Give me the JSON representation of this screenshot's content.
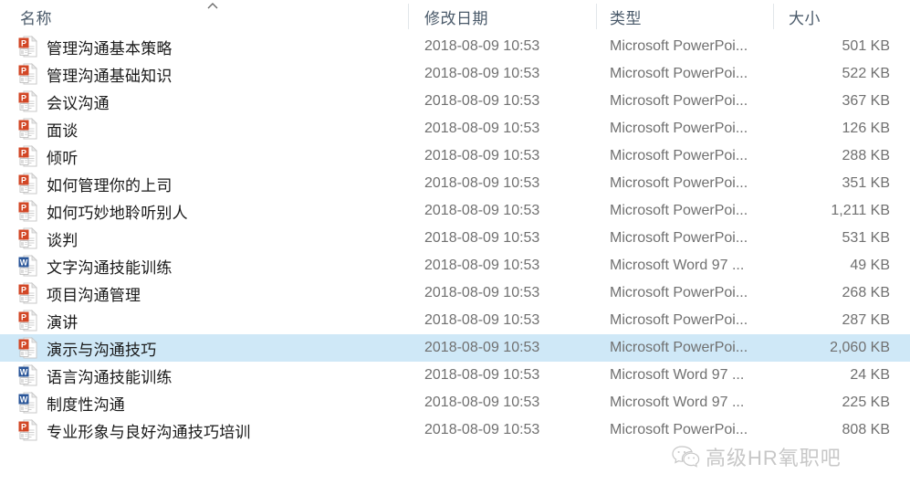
{
  "window": {
    "view": "details",
    "sort_column": "名称",
    "sort_direction": "ascending"
  },
  "columns": {
    "name": "名称",
    "date_modified": "修改日期",
    "type": "类型",
    "size": "大小"
  },
  "colors": {
    "selection": "#cfe8f7",
    "powerpoint_icon": "#d24726",
    "word_icon": "#2a5699",
    "header_text": "#4a5a6a",
    "row_text": "#1a1a1a",
    "meta_text": "#707070"
  },
  "watermark": {
    "text": "高级HR氧职吧",
    "logo": "wechat-icon"
  },
  "files": [
    {
      "name": "管理沟通基本策略",
      "date": "2018-08-09 10:53",
      "type": "Microsoft PowerPoi...",
      "size": "501 KB",
      "icon": "powerpoint-file-icon",
      "selected": false
    },
    {
      "name": "管理沟通基础知识",
      "date": "2018-08-09 10:53",
      "type": "Microsoft PowerPoi...",
      "size": "522 KB",
      "icon": "powerpoint-file-icon",
      "selected": false
    },
    {
      "name": "会议沟通",
      "date": "2018-08-09 10:53",
      "type": "Microsoft PowerPoi...",
      "size": "367 KB",
      "icon": "powerpoint-file-icon",
      "selected": false
    },
    {
      "name": "面谈",
      "date": "2018-08-09 10:53",
      "type": "Microsoft PowerPoi...",
      "size": "126 KB",
      "icon": "powerpoint-file-icon",
      "selected": false
    },
    {
      "name": "倾听",
      "date": "2018-08-09 10:53",
      "type": "Microsoft PowerPoi...",
      "size": "288 KB",
      "icon": "powerpoint-file-icon",
      "selected": false
    },
    {
      "name": "如何管理你的上司",
      "date": "2018-08-09 10:53",
      "type": "Microsoft PowerPoi...",
      "size": "351 KB",
      "icon": "powerpoint-file-icon",
      "selected": false
    },
    {
      "name": "如何巧妙地聆听别人",
      "date": "2018-08-09 10:53",
      "type": "Microsoft PowerPoi...",
      "size": "1,211 KB",
      "icon": "powerpoint-file-icon",
      "selected": false
    },
    {
      "name": "谈判",
      "date": "2018-08-09 10:53",
      "type": "Microsoft PowerPoi...",
      "size": "531 KB",
      "icon": "powerpoint-file-icon",
      "selected": false
    },
    {
      "name": "文字沟通技能训练",
      "date": "2018-08-09 10:53",
      "type": "Microsoft Word 97 ...",
      "size": "49 KB",
      "icon": "word-file-icon",
      "selected": false
    },
    {
      "name": "项目沟通管理",
      "date": "2018-08-09 10:53",
      "type": "Microsoft PowerPoi...",
      "size": "268 KB",
      "icon": "powerpoint-file-icon",
      "selected": false
    },
    {
      "name": "演讲",
      "date": "2018-08-09 10:53",
      "type": "Microsoft PowerPoi...",
      "size": "287 KB",
      "icon": "powerpoint-file-icon",
      "selected": false
    },
    {
      "name": "演示与沟通技巧",
      "date": "2018-08-09 10:53",
      "type": "Microsoft PowerPoi...",
      "size": "2,060 KB",
      "icon": "powerpoint-file-icon",
      "selected": true
    },
    {
      "name": "语言沟通技能训练",
      "date": "2018-08-09 10:53",
      "type": "Microsoft Word 97 ...",
      "size": "24 KB",
      "icon": "word-file-icon",
      "selected": false
    },
    {
      "name": "制度性沟通",
      "date": "2018-08-09 10:53",
      "type": "Microsoft Word 97 ...",
      "size": "225 KB",
      "icon": "word-file-icon",
      "selected": false
    },
    {
      "name": "专业形象与良好沟通技巧培训",
      "date": "2018-08-09 10:53",
      "type": "Microsoft PowerPoi...",
      "size": "808 KB",
      "icon": "powerpoint-file-icon",
      "selected": false
    }
  ]
}
